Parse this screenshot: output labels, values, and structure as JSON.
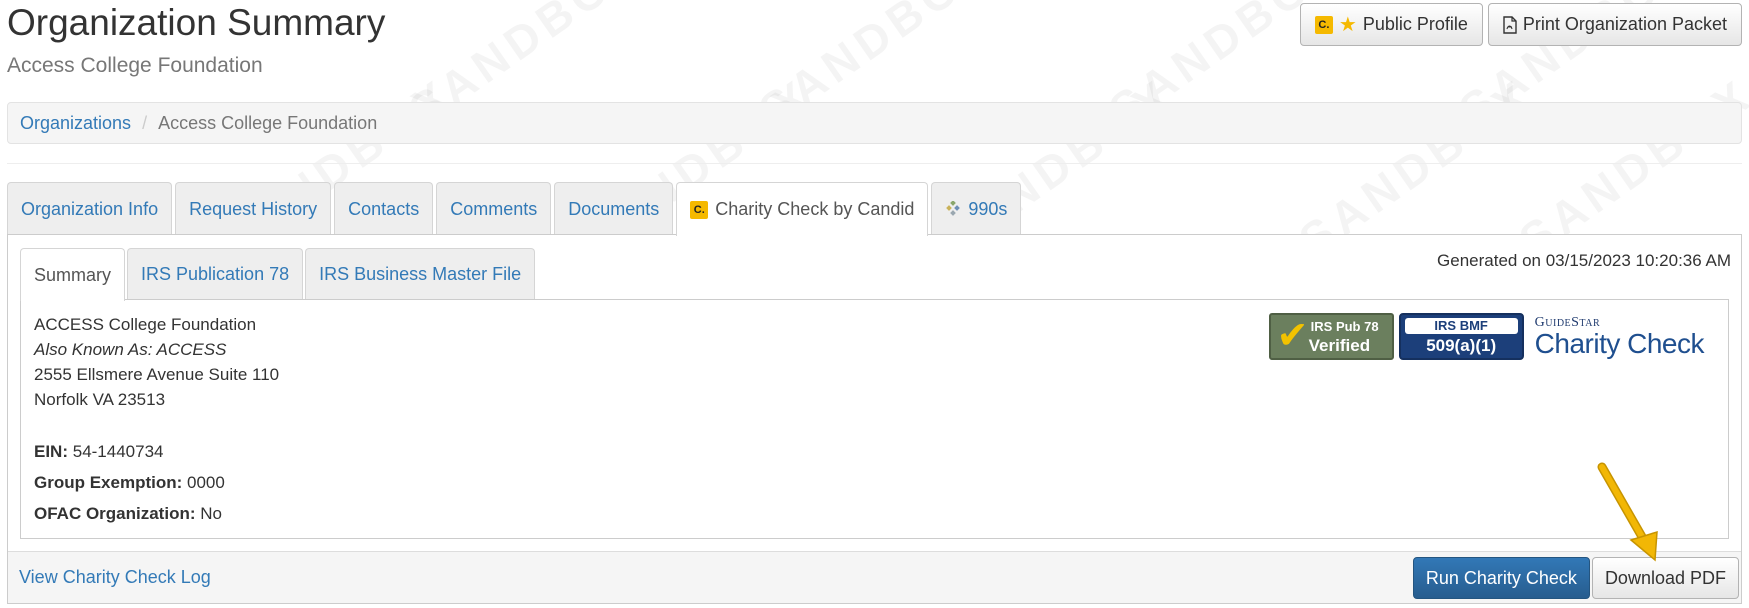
{
  "page": {
    "title": "Organization Summary",
    "subtitle": "Access College Foundation"
  },
  "watermark_text": "SANDBOX",
  "header_actions": {
    "public_profile_badge": "C.",
    "public_profile_label": "Public Profile",
    "print_packet_label": "Print Organization Packet"
  },
  "breadcrumb": {
    "root": "Organizations",
    "separator": "/",
    "current": "Access College Foundation"
  },
  "tabs": [
    {
      "label": "Organization Info"
    },
    {
      "label": "Request History"
    },
    {
      "label": "Contacts"
    },
    {
      "label": "Comments"
    },
    {
      "label": "Documents"
    },
    {
      "label": "Charity Check by Candid",
      "badge": "C.",
      "active": true
    },
    {
      "label": "990s"
    }
  ],
  "subtabs": [
    {
      "label": "Summary",
      "active": true
    },
    {
      "label": "IRS Publication 78"
    },
    {
      "label": "IRS Business Master File"
    }
  ],
  "generated_on": "Generated on 03/15/2023 10:20:36 AM",
  "organization": {
    "name": "ACCESS College Foundation",
    "aka": "Also Known As: ACCESS",
    "address_line1": "2555 Ellsmere Avenue Suite 110",
    "address_line2": "Norfolk VA 23513"
  },
  "fields": {
    "ein_label": "EIN:",
    "ein_value": "54-1440734",
    "group_exemption_label": "Group Exemption:",
    "group_exemption_value": "0000",
    "ofac_label": "OFAC Organization:",
    "ofac_value": "No"
  },
  "badges": {
    "pub78_line1": "IRS Pub 78",
    "pub78_line2": "Verified",
    "bmf_line1": "IRS BMF",
    "bmf_line2": "509(a)(1)",
    "guidestar_line1": "GuideStar",
    "guidestar_line2": "Charity Check"
  },
  "footer": {
    "log_link": "View Charity Check Log",
    "run_button": "Run Charity Check",
    "download_button": "Download PDF"
  },
  "colors": {
    "link": "#337ab7",
    "primary": "#2b6aa3",
    "candid_yellow": "#f5b900",
    "arrow": "#f2b705"
  },
  "icons": [
    "candid-c-icon",
    "star-icon",
    "pdf-icon",
    "form-990-icon",
    "checkmark-icon",
    "arrow-annotation-icon"
  ]
}
